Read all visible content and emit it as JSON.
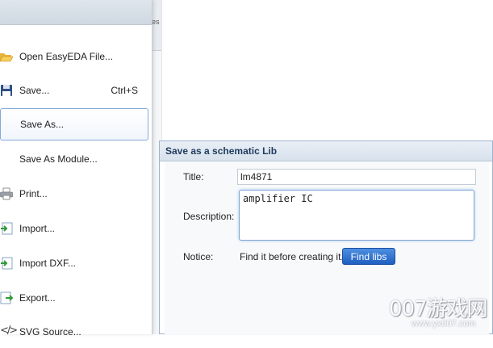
{
  "menu": {
    "items": [
      {
        "label": "Open EasyEDA File...",
        "icon": "folder-open-icon",
        "shortcut": ""
      },
      {
        "label": "Save...",
        "icon": "floppy-disk-icon",
        "shortcut": "Ctrl+S"
      },
      {
        "label": "Save As...",
        "icon": "",
        "shortcut": ""
      },
      {
        "label": "Save As Module...",
        "icon": "",
        "shortcut": ""
      },
      {
        "label": "Print...",
        "icon": "printer-icon",
        "shortcut": ""
      },
      {
        "label": "Import...",
        "icon": "import-icon",
        "shortcut": ""
      },
      {
        "label": "Import DXF...",
        "icon": "import-dxf-icon",
        "shortcut": ""
      },
      {
        "label": "Export...",
        "icon": "export-icon",
        "shortcut": ""
      },
      {
        "label": "SVG Source...",
        "icon": "code-brackets-icon",
        "shortcut": ""
      }
    ],
    "active_item": "Save As..."
  },
  "dialog": {
    "title": "Save as a schematic Lib",
    "title_label": "Title:",
    "title_value": "lm4871",
    "description_label": "Description:",
    "description_value": "amplifier IC",
    "notice_label": "Notice:",
    "notice_text": "Find it before creating it.",
    "find_button_label": "Find libs"
  },
  "background": {
    "tab_fragment": "es"
  },
  "watermark": {
    "logo_text": "007游戏网",
    "url": "www.yx007.com"
  },
  "colors": {
    "accent": "#2f6fd0",
    "dialog_title_text": "#1f3b5c",
    "active_border": "#86a9d8"
  }
}
